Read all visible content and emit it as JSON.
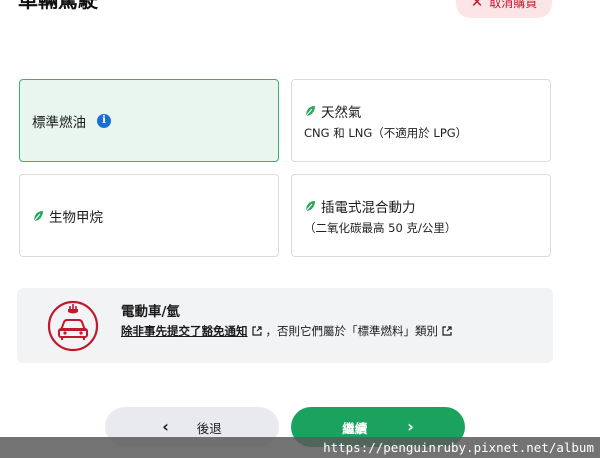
{
  "header": {
    "title": "車輛駕駛",
    "cancel_label": "取消購買",
    "cancel_icon": "close-icon"
  },
  "fuel_options": [
    {
      "label": "標準燃油",
      "sub": "",
      "icon": "info-icon",
      "selected": true
    },
    {
      "label": "天然氣",
      "sub": "CNG 和 LNG（不適用於 LPG）",
      "icon": "leaf-icon",
      "selected": false
    },
    {
      "label": "生物甲烷",
      "sub": "",
      "icon": "leaf-icon",
      "selected": false
    },
    {
      "label": "插電式混合動力",
      "sub": "（二氧化碳最高 50 克/公里）",
      "icon": "leaf-icon",
      "selected": false
    }
  ],
  "ev_notice": {
    "title": "電動車/氫",
    "link_text": "除非事先提交了豁免通知",
    "rest_text": "，否則它們屬於「標準燃料」類別",
    "icon": "electric-car-icon"
  },
  "nav": {
    "back_label": "後退",
    "next_label": "繼續"
  },
  "watermark": "https://penguinruby.pixnet.net/album",
  "colors": {
    "accent_green": "#1aa25e",
    "selected_bg": "#e8f6ef",
    "danger_red": "#c0192d",
    "info_blue": "#1a6fd6"
  }
}
